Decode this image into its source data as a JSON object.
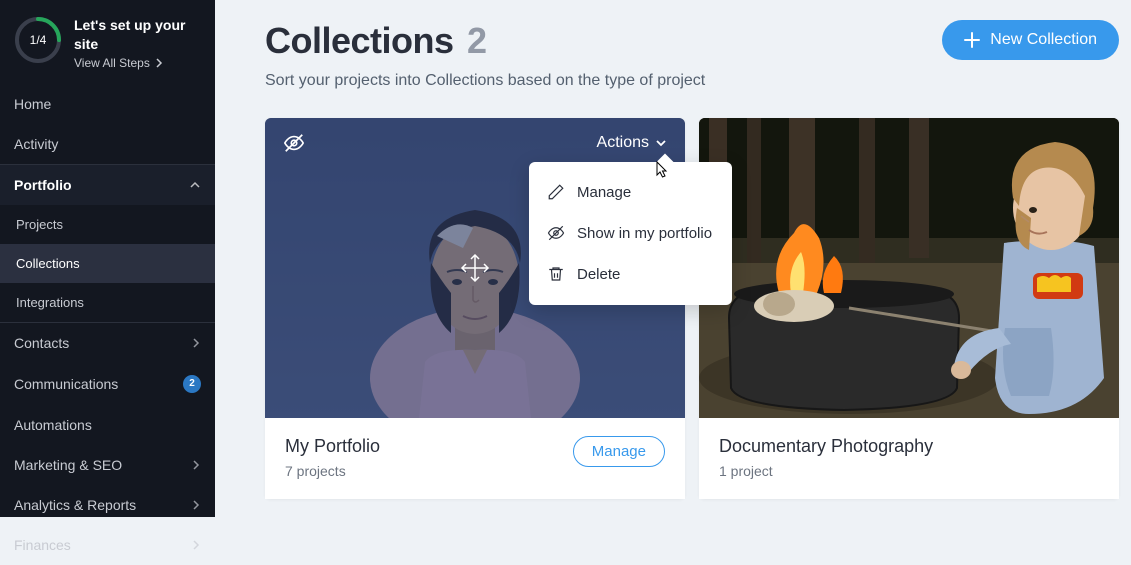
{
  "colors": {
    "accent": "#3899ec",
    "sidebarBg": "#131720"
  },
  "setup": {
    "progress": "1/4",
    "title": "Let's set up your site",
    "link": "View All Steps"
  },
  "nav": {
    "home": "Home",
    "activity": "Activity",
    "portfolio": "Portfolio",
    "projects": "Projects",
    "collections": "Collections",
    "integrations": "Integrations",
    "contacts": "Contacts",
    "communications": "Communications",
    "communicationsBadge": "2",
    "automations": "Automations",
    "marketing": "Marketing & SEO",
    "analytics": "Analytics & Reports",
    "finances": "Finances"
  },
  "header": {
    "title": "Collections",
    "count": "2",
    "subtitle": "Sort your projects into Collections based on the type of project",
    "newBtn": "New Collection"
  },
  "card1": {
    "actionsLabel": "Actions",
    "title": "My Portfolio",
    "sub": "7 projects",
    "manage": "Manage"
  },
  "card2": {
    "title": "Documentary Photography",
    "sub": "1 project"
  },
  "dropdown": {
    "manage": "Manage",
    "show": "Show in my portfolio",
    "delete": "Delete"
  }
}
